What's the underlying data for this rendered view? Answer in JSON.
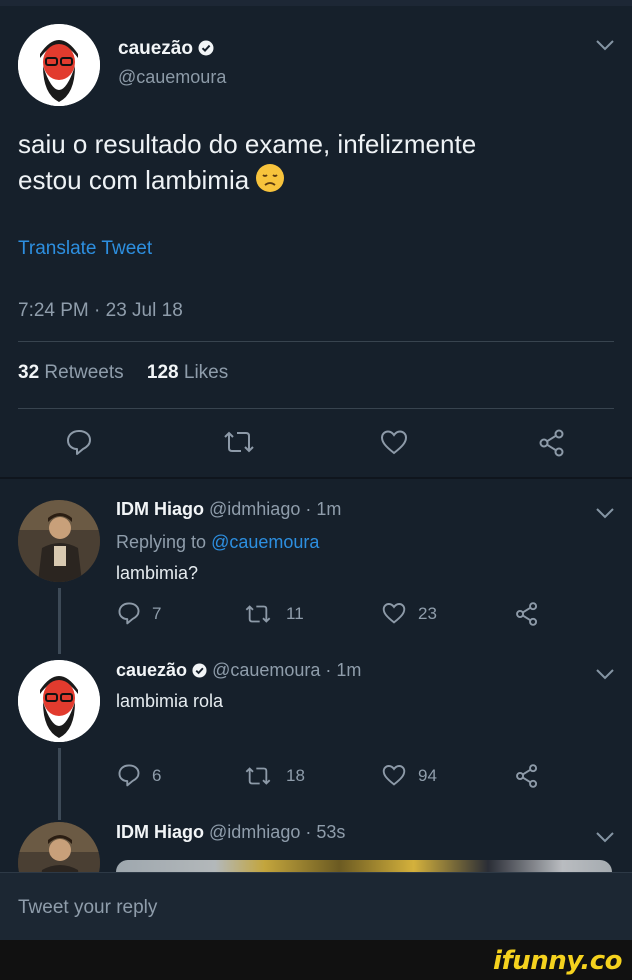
{
  "main_tweet": {
    "author_name": "cauezão",
    "author_handle": "@cauemoura",
    "text_line1": "saiu o resultado do exame, infelizmente",
    "text_line2": "estou com lambimia",
    "emoji": "disappointed-face",
    "translate_label": "Translate Tweet",
    "timestamp": "7:24 PM · 23 Jul 18",
    "retweets_count": "32",
    "retweets_label": "Retweets",
    "likes_count": "128",
    "likes_label": "Likes"
  },
  "replies": [
    {
      "author_name": "IDM Hiago",
      "author_meta": "@idmhiago · 1m",
      "replying_prefix": "Replying to",
      "replying_to": "@cauemoura",
      "text": "lambimia?",
      "reply_count": "7",
      "retweet_count": "11",
      "like_count": "23"
    },
    {
      "author_name": "cauezão",
      "author_meta": "@cauemoura · 1m",
      "text": "lambimia rola",
      "reply_count": "6",
      "retweet_count": "18",
      "like_count": "94"
    },
    {
      "author_name": "IDM Hiago",
      "author_meta": "@idmhiago · 53s"
    }
  ],
  "compose": {
    "placeholder": "Tweet your reply"
  },
  "watermark": "ifunny.co",
  "colors": {
    "background": "#16202b",
    "link": "#2d8fe0",
    "muted": "#8f9dab",
    "watermark": "#f5d21e"
  }
}
